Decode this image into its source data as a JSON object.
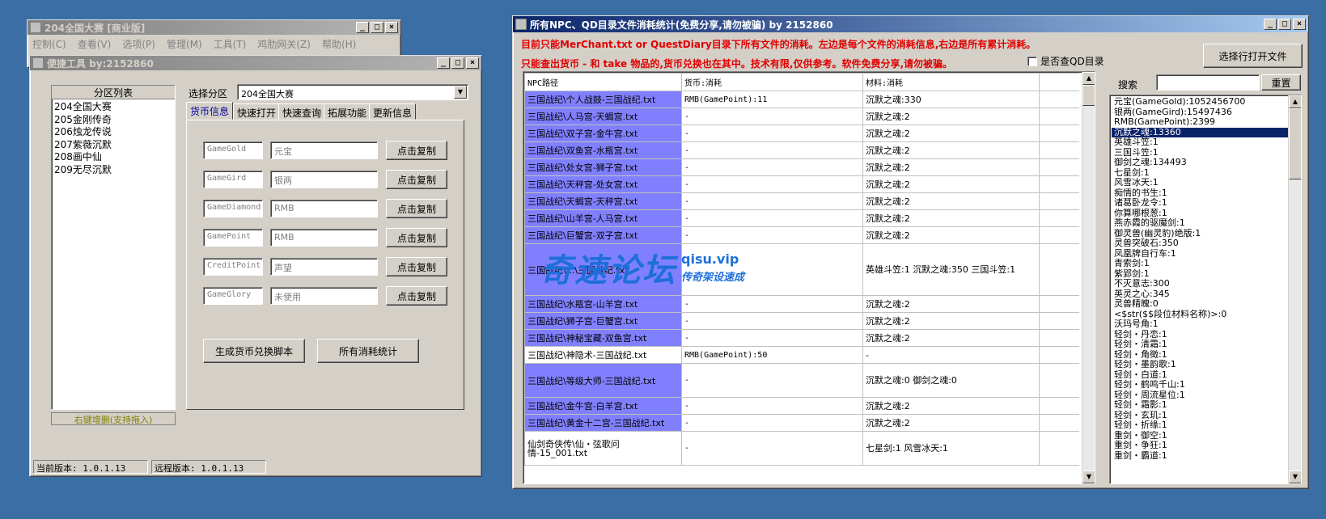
{
  "back_window": {
    "title": "204全国大赛 [商业版]",
    "menus": [
      "控制(C)",
      "查看(V)",
      "选项(P)",
      "管理(M)",
      "工具(T)",
      "鸡肋网关(Z)",
      "帮助(H)"
    ]
  },
  "tool_window": {
    "title": "便捷工具  by:2152860",
    "list_header": "分区列表",
    "zones": [
      "204全国大赛",
      "205金刚传奇",
      "206烛龙传说",
      "207紫薇沉默",
      "208画中仙",
      "209无尽沉默"
    ],
    "list_footer": "右键增删(支持拖入)",
    "select_zone_label": "选择分区",
    "select_zone_value": "204全国大赛",
    "tabs": [
      "货币信息",
      "快速打开",
      "快速查询",
      "拓展功能",
      "更新信息"
    ],
    "currency_rows": [
      {
        "key": "GameGold",
        "name": "元宝",
        "button": "点击复制"
      },
      {
        "key": "GameGird",
        "name": "银两",
        "button": "点击复制"
      },
      {
        "key": "GameDiamond",
        "name": "RMB",
        "button": "点击复制"
      },
      {
        "key": "GamePoint",
        "name": "RMB",
        "button": "点击复制"
      },
      {
        "key": "CreditPoint",
        "name": "声望",
        "button": "点击复制"
      },
      {
        "key": "GameGlory",
        "name": "未使用",
        "button": "点击复制"
      }
    ],
    "gen_script_button": "生成货币兑换脚本",
    "all_stats_button": "所有消耗统计",
    "status_local": "当前版本: 1.0.1.13",
    "status_remote": "远程版本: 1.0.1.13"
  },
  "stats_window": {
    "title": "所有NPC、QD目录文件消耗统计(免费分享,请勿被骗)    by 2152860",
    "notice1": "目前只能MerChant.txt or QuestDiary目录下所有文件的消耗。左边是每个文件的消耗信息,右边是所有累计消耗。",
    "notice2": "只能查出货币 - 和 take 物品的,货币兑换也在其中。技术有限,仅供参考。软件免费分享,请勿被骗。",
    "qd_checkbox_label": "是否查QD目录",
    "open_button": "选择行打开文件",
    "search_label": "搜索",
    "search_value": "",
    "reset_button": "重置",
    "columns": [
      "NPC路径",
      "货币:消耗",
      "材料:消耗"
    ],
    "rows": [
      {
        "path": "三国战纪\\个人战鼓-三国战纪.txt",
        "currency": "RMB(GamePoint):11",
        "material": "沉默之魂:330",
        "hl": true
      },
      {
        "path": "三国战纪\\人马宫-天蝎宫.txt",
        "currency": "-",
        "material": "沉默之魂:2",
        "hl": true
      },
      {
        "path": "三国战纪\\双子宫-金牛宫.txt",
        "currency": "-",
        "material": "沉默之魂:2",
        "hl": true
      },
      {
        "path": "三国战纪\\双鱼宫-水瓶宫.txt",
        "currency": "-",
        "material": "沉默之魂:2",
        "hl": true
      },
      {
        "path": "三国战纪\\处女宫-狮子宫.txt",
        "currency": "-",
        "material": "沉默之魂:2",
        "hl": true
      },
      {
        "path": "三国战纪\\天秤宫-处女宫.txt",
        "currency": "-",
        "material": "沉默之魂:2",
        "hl": true
      },
      {
        "path": "三国战纪\\天蝎宫-天秤宫.txt",
        "currency": "-",
        "material": "沉默之魂:2",
        "hl": true
      },
      {
        "path": "三国战纪\\山羊宫-人马宫.txt",
        "currency": "-",
        "material": "沉默之魂:2",
        "hl": true
      },
      {
        "path": "三国战纪\\巨蟹宫-双子宫.txt",
        "currency": "-",
        "material": "沉默之魂:2",
        "hl": true
      },
      {
        "path": "三国战纪\\...\\三国战纪.txt",
        "currency": "",
        "material": "英雄斗笠:1\n沉默之魂:350\n三国斗笠:1",
        "hl": true,
        "tall": true
      },
      {
        "path": "三国战纪\\水瓶宫-山羊宫.txt",
        "currency": "-",
        "material": "沉默之魂:2",
        "hl": true
      },
      {
        "path": "三国战纪\\狮子宫-巨蟹宫.txt",
        "currency": "-",
        "material": "沉默之魂:2",
        "hl": true
      },
      {
        "path": "三国战纪\\神秘宝藏-双鱼宫.txt",
        "currency": "-",
        "material": "沉默之魂:2",
        "hl": true
      },
      {
        "path": "三国战纪\\神隐术-三国战纪.txt",
        "currency": "RMB(GamePoint):50",
        "material": "-",
        "hl": false
      },
      {
        "path": "三国战纪\\等级大师-三国战纪.txt",
        "currency": "-",
        "material": "沉默之魂:0\n御剑之魂:0",
        "hl": true,
        "mid": true
      },
      {
        "path": "三国战纪\\金牛宫-白羊宫.txt",
        "currency": "-",
        "material": "沉默之魂:2",
        "hl": true
      },
      {
        "path": "三国战纪\\黄金十二宫-三国战纪.txt",
        "currency": "-",
        "material": "沉默之魂:2",
        "hl": true
      },
      {
        "path": "仙剑奇侠传\\仙・弦歌问情-15_001.txt",
        "currency": "-",
        "material": "七星剑:1\n风雪冰天:1",
        "hl": false,
        "mid": true
      }
    ],
    "totals": [
      "元宝(GameGold):1052456700",
      "银两(GameGird):15497436",
      "RMB(GamePoint):2399",
      "沉默之魂:13360",
      "英雄斗笠:1",
      "三国斗笠:1",
      "御剑之魂:134493",
      "七星剑:1",
      "风雪冰天:1",
      "痴情的书生:1",
      "诸葛卧龙令:1",
      "你算哪根葱:1",
      "燕赤霞的驱魔剑:1",
      "御灵兽(幽灵豹)绝版:1",
      "灵兽突破石:350",
      "凤凰牌自行车:1",
      "青索剑:1",
      "紫郢剑:1",
      "不灭意志:300",
      "英灵之心:345",
      "灵兽精魄:0",
      "<$str($$段位材料名称)>:0",
      "沃玛号角:1",
      "轻剑・丹恋:1",
      "轻剑・清霜:1",
      "轻剑・角徵:1",
      "轻剑・墨韵歌:1",
      "轻剑・白道:1",
      "轻剑・鹤鸣千山:1",
      "轻剑・周流星位:1",
      "轻剑・霜影:1",
      "轻剑・玄玑:1",
      "轻剑・折缘:1",
      "重剑・御空:1",
      "重剑・争狂:1",
      "重剑・霸道:1"
    ],
    "selected_total_index": 3
  },
  "watermark": {
    "cn": "奇速论坛",
    "domain": "qisu.vip",
    "slogan": "传奇架设速成"
  },
  "colors": {
    "desktop": "#3a6ea5",
    "highlight_row": "#8080ff",
    "notice_red": "#e00000",
    "watermark_blue": "#1e6fd9"
  }
}
